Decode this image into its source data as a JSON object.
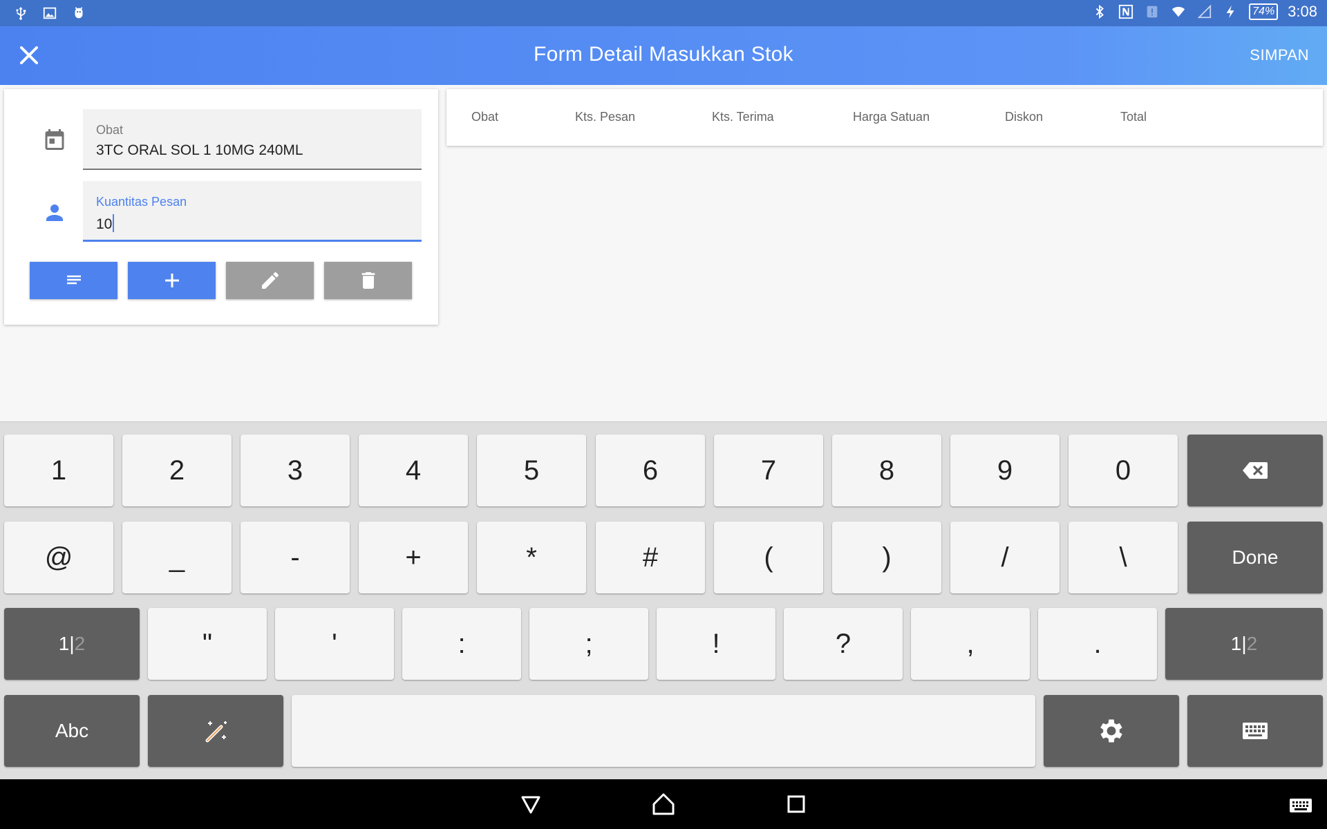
{
  "status_bar": {
    "battery": "74%",
    "time": "3:08",
    "left_icons": [
      "usb-icon",
      "image-icon",
      "android-icon"
    ],
    "right_icons": [
      "bluetooth-icon",
      "nfc-icon",
      "alert-icon",
      "wifi-icon",
      "signal-icon",
      "charging-icon",
      "battery-icon"
    ]
  },
  "app_bar": {
    "title": "Form Detail Masukkan Stok",
    "save_label": "SIMPAN"
  },
  "form": {
    "obat": {
      "label": "Obat",
      "value": "3TC ORAL SOL 1 10MG 240ML",
      "icon": "calendar-icon"
    },
    "kuantitas": {
      "label": "Kuantitas Pesan",
      "value": "10",
      "icon": "person-icon"
    },
    "buttons": [
      {
        "icon": "list-icon",
        "color": "#4e82ef"
      },
      {
        "icon": "plus-icon",
        "color": "#4e82ef"
      },
      {
        "icon": "pencil-icon",
        "color": "#9e9e9e"
      },
      {
        "icon": "trash-icon",
        "color": "#9e9e9e"
      }
    ]
  },
  "table": {
    "columns": [
      "Obat",
      "Kts. Pesan",
      "Kts. Terima",
      "Harga Satuan",
      "Diskon",
      "Total"
    ]
  },
  "keyboard": {
    "row1": [
      "1",
      "2",
      "3",
      "4",
      "5",
      "6",
      "7",
      "8",
      "9",
      "0"
    ],
    "row2": [
      "@",
      "_",
      "-",
      "+",
      "*",
      "#",
      "(",
      ")",
      "/",
      "\\"
    ],
    "done_label": "Done",
    "page_label": {
      "current": "1",
      "separator": "|",
      "other": "2"
    },
    "row3": [
      "\"",
      "'",
      ":",
      ";",
      "!",
      "?",
      ",",
      "."
    ],
    "abc_label": "Abc",
    "special_icons": [
      "backspace-icon",
      "magic-wand-icon",
      "settings-icon",
      "keyboard-icon"
    ]
  },
  "nav_bar": {
    "icons": [
      "back-icon",
      "home-icon",
      "recents-icon",
      "keyboard-switch-icon"
    ]
  },
  "colors": {
    "accent": "#4e82ef",
    "status_bar": "#3f72c9",
    "key_dark": "#5f5f5f"
  }
}
